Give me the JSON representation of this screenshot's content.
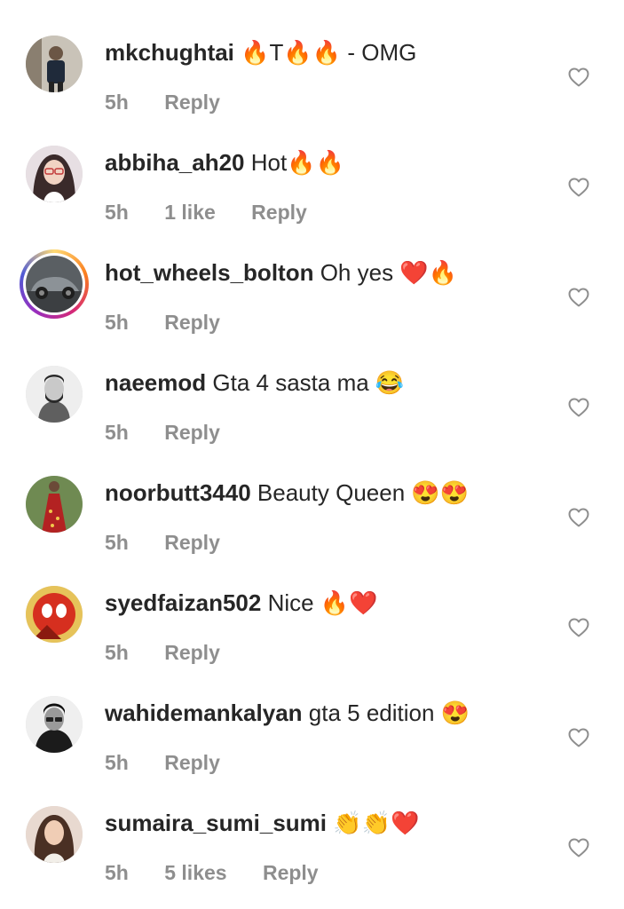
{
  "comments": [
    {
      "username": "mkchughtai",
      "text": "🔥T🔥🔥 - OMG",
      "time": "5h",
      "likes": "",
      "reply": "Reply"
    },
    {
      "username": "abbiha_ah20",
      "text": "Hot🔥🔥",
      "time": "5h",
      "likes": "1 like",
      "reply": "Reply"
    },
    {
      "username": "hot_wheels_bolton",
      "text": "Oh yes ❤️🔥",
      "time": "5h",
      "likes": "",
      "reply": "Reply"
    },
    {
      "username": "naeemod",
      "text": "Gta 4 sasta ma 😂",
      "time": "5h",
      "likes": "",
      "reply": "Reply"
    },
    {
      "username": "noorbutt3440",
      "text": "Beauty Queen 😍😍",
      "time": "5h",
      "likes": "",
      "reply": "Reply"
    },
    {
      "username": "syedfaizan502",
      "text": "Nice 🔥❤️",
      "time": "5h",
      "likes": "",
      "reply": "Reply"
    },
    {
      "username": "wahidemankalyan",
      "text": "gta 5 edition 😍",
      "time": "5h",
      "likes": "",
      "reply": "Reply"
    },
    {
      "username": "sumaira_sumi_sumi",
      "text": "👏👏❤️",
      "time": "5h",
      "likes": "5 likes",
      "reply": "Reply"
    }
  ],
  "icons": {
    "like": "heart-outline-icon"
  },
  "colors": {
    "username": "#262626",
    "meta": "#8e8e8e",
    "story_ring": "#d62976"
  }
}
